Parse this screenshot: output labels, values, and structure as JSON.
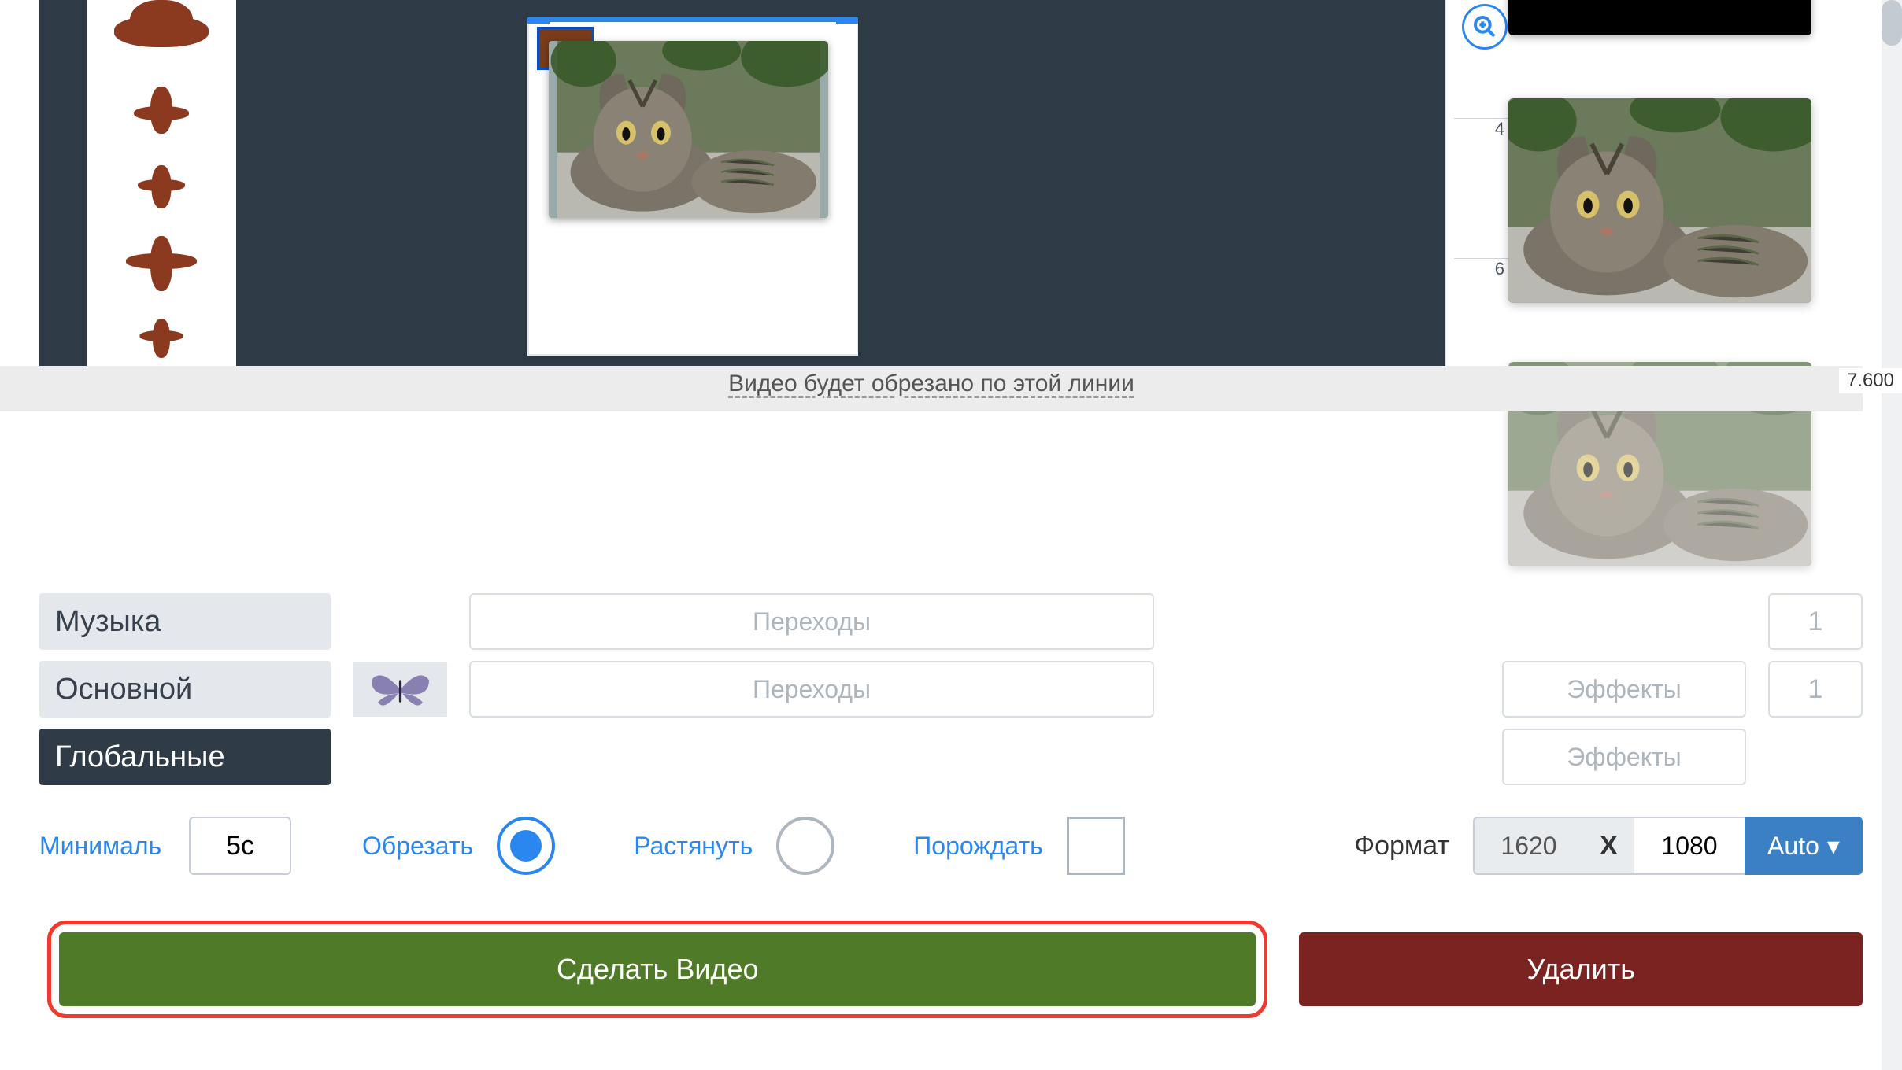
{
  "timeline": {
    "ruler_ticks": [
      "4",
      "6"
    ],
    "cut_time": "7.600",
    "cut_line_text": "Видео будет обрезано по этой линии",
    "zoom_icon": "zoom-in"
  },
  "lanes": {
    "music_label": "Музыка",
    "main_label": "Основной",
    "global_label": "Глобальные",
    "transitions_label": "Переходы",
    "effects_label": "Эффекты",
    "count_1": "1",
    "count_2": "1"
  },
  "duration": {
    "min_label": "Минималь",
    "min_value": "5с",
    "crop_label": "Обрезать",
    "stretch_label": "Растянуть",
    "generate_label": "Порождать",
    "selected": "crop"
  },
  "format": {
    "label": "Формат",
    "width": "1620",
    "sep": "X",
    "height": "1080",
    "auto_label": "Auto"
  },
  "actions": {
    "make_video": "Сделать Видео",
    "delete": "Удалить"
  }
}
